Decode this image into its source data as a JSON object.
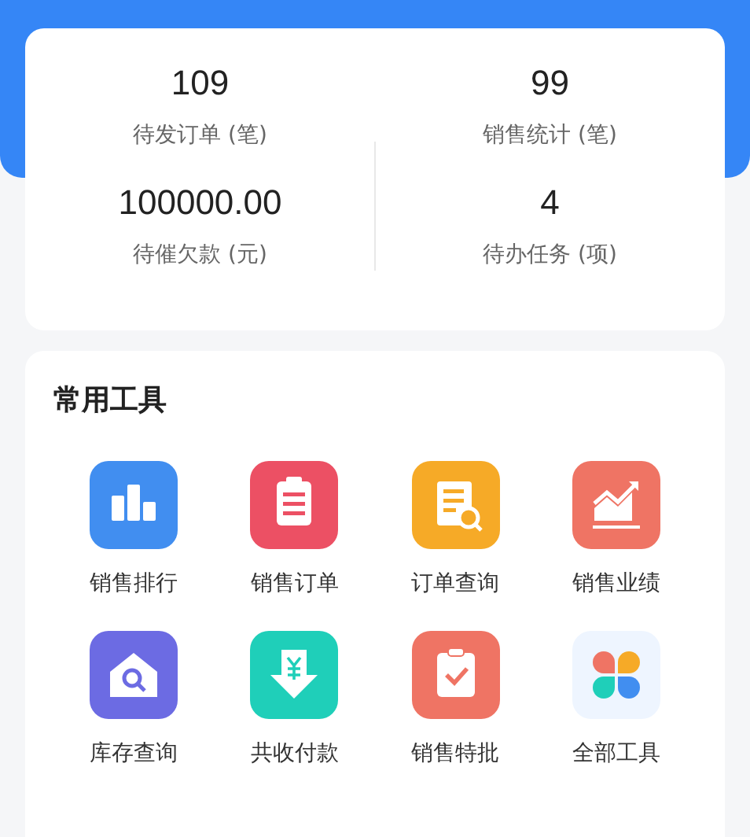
{
  "stats": [
    {
      "value": "109",
      "label": "待发订单 (笔)"
    },
    {
      "value": "99",
      "label": "销售统计 (笔)"
    },
    {
      "value": "100000.00",
      "label": "待催欠款 (元)"
    },
    {
      "value": "4",
      "label": "待办任务 (项)"
    }
  ],
  "tools": {
    "title": "常用工具",
    "items": [
      {
        "kind": "ranking",
        "color": "#418ef0",
        "label": "销售排行"
      },
      {
        "kind": "clipboard",
        "color": "#ec5064",
        "label": "销售订单"
      },
      {
        "kind": "doc-search",
        "color": "#f6aa27",
        "label": "订单查询"
      },
      {
        "kind": "chart",
        "color": "#ef7464",
        "label": "销售业绩"
      },
      {
        "kind": "house-search",
        "color": "#6c6be3",
        "label": "库存查询"
      },
      {
        "kind": "yuan-down",
        "color": "#1fcfb9",
        "label": "共收付款"
      },
      {
        "kind": "check-clip",
        "color": "#ef7464",
        "label": "销售特批"
      },
      {
        "kind": "grid",
        "color": "#eef5ff",
        "label": "全部工具"
      }
    ]
  }
}
